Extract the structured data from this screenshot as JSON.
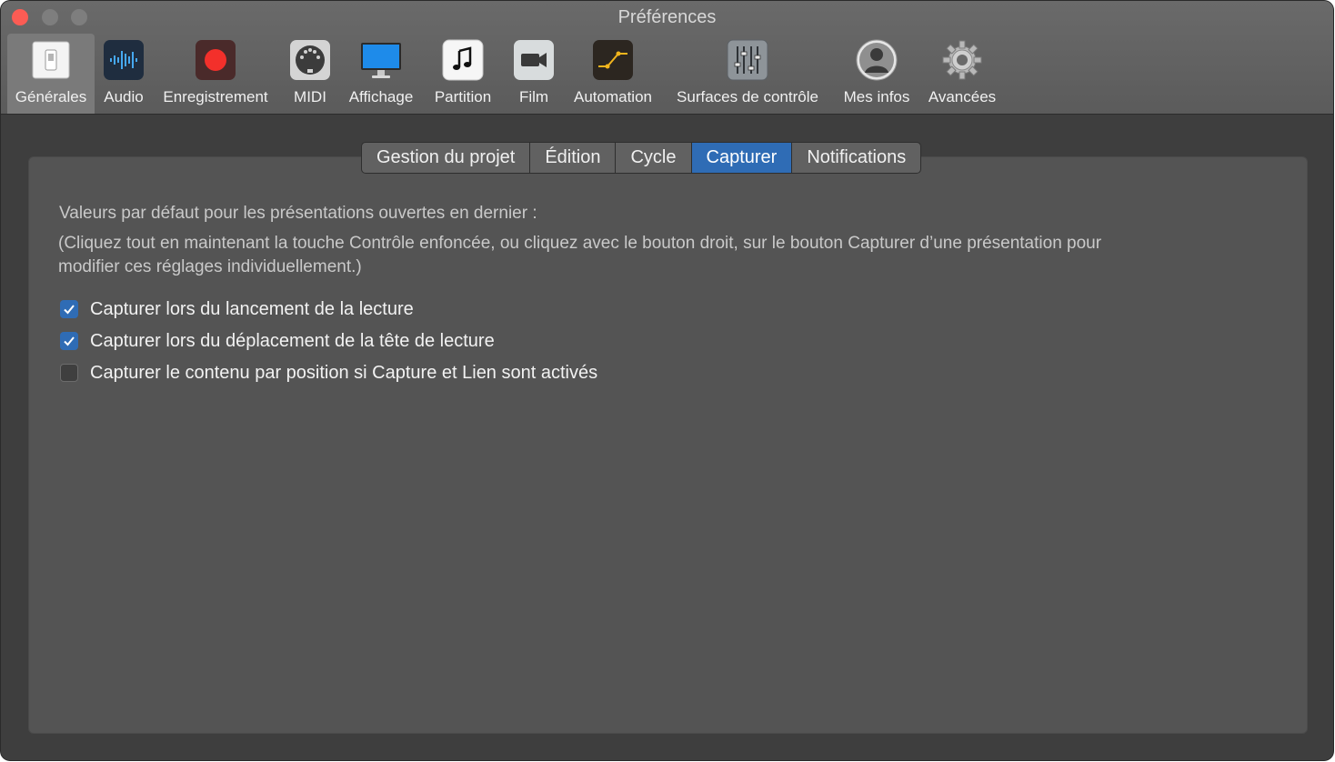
{
  "window": {
    "title": "Préférences"
  },
  "toolbar": {
    "items": [
      {
        "label": "Générales",
        "icon": "switch-icon",
        "selected": true
      },
      {
        "label": "Audio",
        "icon": "waveform-icon",
        "selected": false
      },
      {
        "label": "Enregistrement",
        "icon": "record-icon",
        "selected": false
      },
      {
        "label": "MIDI",
        "icon": "midi-port-icon",
        "selected": false
      },
      {
        "label": "Affichage",
        "icon": "monitor-icon",
        "selected": false
      },
      {
        "label": "Partition",
        "icon": "music-note-icon",
        "selected": false
      },
      {
        "label": "Film",
        "icon": "video-camera-icon",
        "selected": false
      },
      {
        "label": "Automation",
        "icon": "automation-curve-icon",
        "selected": false
      },
      {
        "label": "Surfaces de contrôle",
        "icon": "faders-icon",
        "selected": false
      },
      {
        "label": "Mes infos",
        "icon": "user-silhouette-icon",
        "selected": false
      },
      {
        "label": "Avancées",
        "icon": "gear-icon",
        "selected": false
      }
    ]
  },
  "tabs": [
    {
      "label": "Gestion du projet",
      "active": false
    },
    {
      "label": "Édition",
      "active": false
    },
    {
      "label": "Cycle",
      "active": false
    },
    {
      "label": "Capturer",
      "active": true
    },
    {
      "label": "Notifications",
      "active": false
    }
  ],
  "content": {
    "heading": "Valeurs par défaut pour les présentations ouvertes en dernier :",
    "note_line1": "(Cliquez tout en maintenant la touche Contrôle enfoncée, ou cliquez avec le bouton droit, sur le bouton Capturer d’une présentation pour",
    "note_line2": "modifier ces réglages individuellement.)",
    "options": [
      {
        "label": "Capturer lors du lancement de la lecture",
        "checked": true
      },
      {
        "label": "Capturer lors du déplacement de la tête de lecture",
        "checked": true
      },
      {
        "label": "Capturer le contenu par position si Capture et Lien sont activés",
        "checked": false
      }
    ]
  },
  "colors": {
    "accent": "#2f6cb5",
    "close_button": "#fc5c54",
    "panel_background": "#545454",
    "window_background": "#3e3e3e"
  }
}
